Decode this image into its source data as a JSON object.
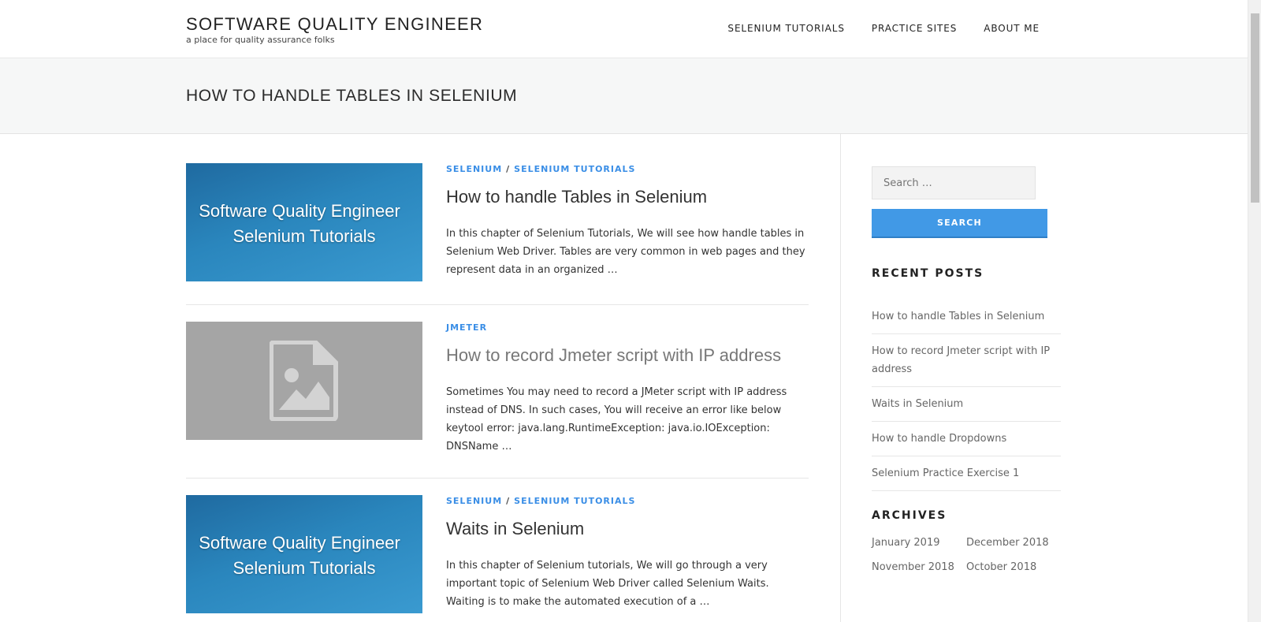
{
  "header": {
    "site_title": "SOFTWARE QUALITY ENGINEER",
    "tagline": "a place for quality assurance folks",
    "nav": [
      "SELENIUM TUTORIALS",
      "PRACTICE SITES",
      "ABOUT ME"
    ]
  },
  "page": {
    "title": "HOW TO HANDLE TABLES IN SELENIUM"
  },
  "posts": [
    {
      "categories": [
        "SELENIUM",
        "SELENIUM TUTORIALS"
      ],
      "title": "How to handle Tables in Selenium",
      "thumb_lines": [
        "Software Quality Engineer",
        "Selenium Tutorials"
      ],
      "excerpt": "In this chapter of Selenium Tutorials, We will see how handle tables in Selenium Web Driver. Tables are very common in web pages and they represent data in an organized …"
    },
    {
      "categories": [
        "JMETER"
      ],
      "title": "How to record Jmeter script with IP address",
      "thumb_icon": "image-placeholder-icon",
      "excerpt": "Sometimes You may need to record a JMeter script with IP address instead of DNS. In such cases, You will receive an error like below keytool error: java.lang.RuntimeException: java.io.IOException: DNSName …"
    },
    {
      "categories": [
        "SELENIUM",
        "SELENIUM TUTORIALS"
      ],
      "title": "Waits in Selenium",
      "thumb_lines": [
        "Software Quality Engineer",
        "Selenium Tutorials"
      ],
      "excerpt": "In this chapter of Selenium tutorials, We will go through a very important topic of Selenium Web Driver called Selenium Waits. Waiting is to make the automated execution of a …"
    }
  ],
  "sidebar": {
    "search": {
      "placeholder": "Search …",
      "button_label": "SEARCH"
    },
    "recent_posts": {
      "title": "RECENT POSTS",
      "items": [
        "How to handle Tables in Selenium",
        "How to record Jmeter script with IP address",
        "Waits in Selenium",
        "How to handle Dropdowns",
        "Selenium Practice Exercise 1"
      ]
    },
    "archives": {
      "title": "ARCHIVES",
      "items": [
        "January 2019",
        "December 2018",
        "November 2018",
        "October 2018"
      ]
    }
  },
  "colors": {
    "accent": "#3a8ee6",
    "button": "#4199e6",
    "page_header_bg": "#f6f7f7"
  }
}
